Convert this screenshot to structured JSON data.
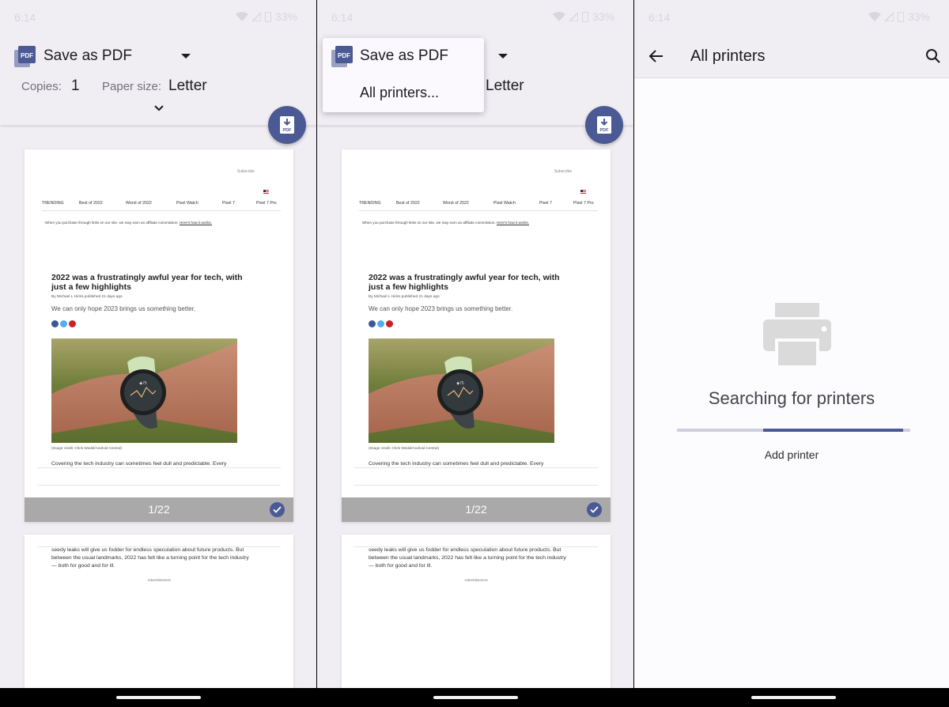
{
  "status_bar": {
    "time": "6:14",
    "battery": "33%"
  },
  "print_options": {
    "printer_name": "Save as PDF",
    "copies_label": "Copies:",
    "copies_value": "1",
    "paper_size_label": "Paper size:",
    "paper_size_value": "Letter"
  },
  "printer_menu": {
    "items": [
      "Save as PDF",
      "All printers..."
    ]
  },
  "preview": {
    "subscribe": "Subscribe",
    "nav": [
      "TRENDING",
      "Best of 2022",
      "Worst of 2022",
      "Pixel Watch",
      "Pixel 7",
      "Pixel 7 Pro"
    ],
    "disclaimer": "When you purchase through links on our site, we may earn an affiliate commission.",
    "disclaimer_link": "Here's how it works.",
    "title": "2022 was a frustratingly awful year for tech, with just a few highlights",
    "byline": "By Michael L Hicks published 21 days ago",
    "dek": "We can only hope 2023 brings us something better.",
    "image_credit": "(Image credit: Chris Wedel/Android Central)",
    "body_start": "Covering the tech industry can sometimes feel dull and predictable. Every",
    "page_indicator": "1/22",
    "page2_text": "seedy leaks will give us fodder for endless speculation about future products. But between the usual landmarks, 2022 has felt like a turning point for the tech industry — both for good and for ill.",
    "advertisement": "Advertisement"
  },
  "all_printers": {
    "title": "All printers",
    "status": "Searching for printers",
    "add_printer": "Add printer",
    "progress": {
      "start": 0.37,
      "end": 0.97
    }
  },
  "colors": {
    "accent": "#4b5a94",
    "background": "#f0edf3",
    "page_bar": "#a9a9a9"
  }
}
